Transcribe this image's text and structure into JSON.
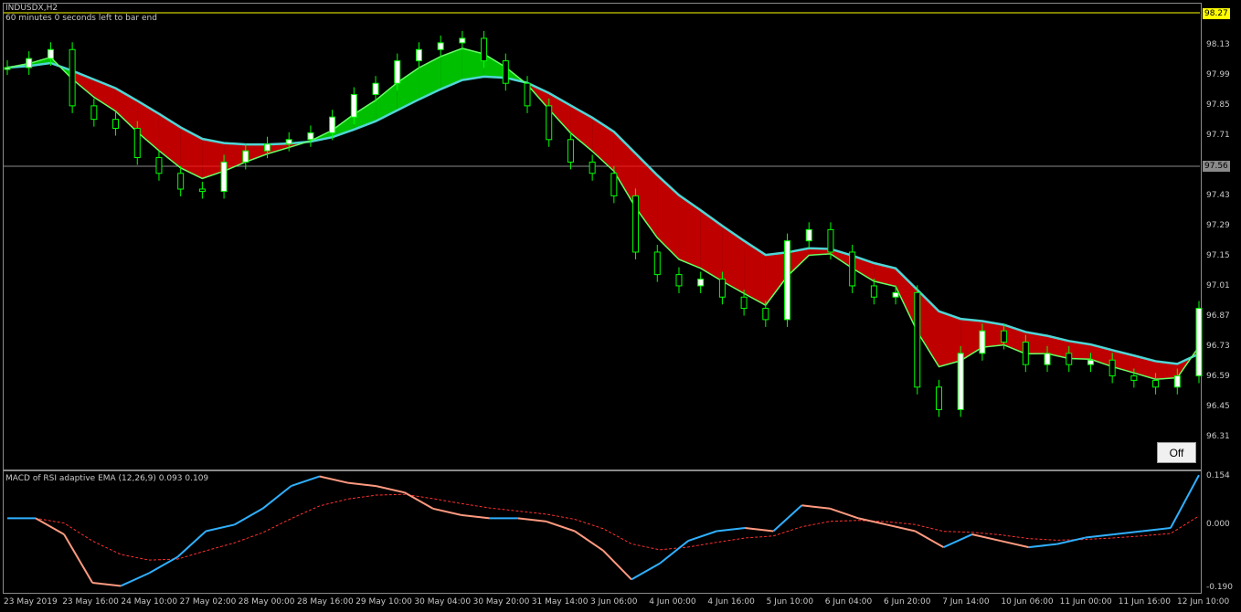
{
  "chart": {
    "symbol": "INDUSDX,H2",
    "timer_text": "60 minutes 0 seconds left to bar end",
    "sub_title": "MACD of RSI adaptive EMA (12,26,9) 0.093 0.109",
    "ask_line_label": "98.27",
    "bid_line_label": "97.56",
    "off_button": "Off",
    "colors": {
      "bull": "#00ff00",
      "bear": "#ff0000",
      "cloud_line": "#4fd6d6",
      "macd_up": "#30b0ff",
      "macd_down": "#ff9a80",
      "signal": "#ff3030",
      "ask_line": "#ffff00",
      "grid": "#8a8a8a"
    }
  },
  "y_axis_main": [
    "98.13",
    "97.99",
    "97.85",
    "97.71",
    "97.43",
    "97.29",
    "97.15",
    "97.01",
    "96.87",
    "96.73",
    "96.59",
    "96.45",
    "96.31"
  ],
  "y_axis_sub": [
    "0.154",
    "0.000",
    "-0.190"
  ],
  "x_axis": [
    "23 May 2019",
    "23 May 16:00",
    "24 May 10:00",
    "27 May 02:00",
    "28 May 00:00",
    "28 May 16:00",
    "29 May 10:00",
    "30 May 04:00",
    "30 May 20:00",
    "31 May 14:00",
    "3 Jun 06:00",
    "4 Jun 00:00",
    "4 Jun 16:00",
    "5 Jun 10:00",
    "6 Jun 04:00",
    "6 Jun 20:00",
    "7 Jun 14:00",
    "10 Jun 06:00",
    "11 Jun 00:00",
    "11 Jun 16:00",
    "12 Jun 10:00"
  ],
  "chart_data": {
    "type": "line",
    "title": "INDUSDX,H2",
    "price_series": {
      "name": "INDUSDX,H2",
      "values": [
        98.02,
        98.06,
        98.1,
        97.85,
        97.79,
        97.75,
        97.62,
        97.55,
        97.48,
        97.47,
        97.6,
        97.65,
        97.68,
        97.7,
        97.73,
        97.8,
        97.9,
        97.95,
        98.05,
        98.1,
        98.13,
        98.15,
        98.05,
        97.95,
        97.85,
        97.7,
        97.6,
        97.55,
        97.45,
        97.2,
        97.1,
        97.05,
        97.08,
        97.0,
        96.95,
        96.9,
        97.25,
        97.3,
        97.2,
        97.05,
        97.0,
        97.02,
        96.6,
        96.5,
        96.75,
        96.85,
        96.8,
        96.7,
        96.75,
        96.7,
        96.72,
        96.65,
        96.63,
        96.6,
        96.65,
        96.95
      ]
    },
    "ylim": [
      96.25,
      98.3
    ],
    "sub_series": {
      "name": "MACD of RSI adaptive EMA (12,26,9)",
      "values": [
        0.02,
        0.02,
        -0.03,
        -0.18,
        -0.19,
        -0.15,
        -0.1,
        -0.02,
        0.0,
        0.05,
        0.12,
        0.15,
        0.13,
        0.12,
        0.1,
        0.05,
        0.03,
        0.02,
        0.02,
        0.01,
        -0.02,
        -0.08,
        -0.17,
        -0.12,
        -0.05,
        -0.02,
        -0.01,
        -0.02,
        0.06,
        0.05,
        0.02,
        0.0,
        -0.02,
        -0.07,
        -0.03,
        -0.05,
        -0.07,
        -0.06,
        -0.04,
        -0.03,
        -0.02,
        -0.01,
        0.154
      ],
      "ylim": [
        -0.2,
        0.16
      ]
    }
  }
}
